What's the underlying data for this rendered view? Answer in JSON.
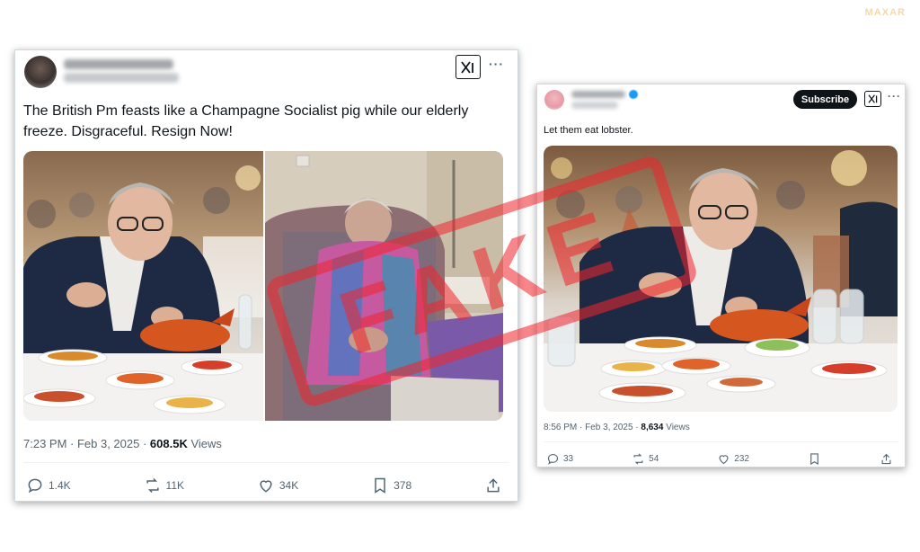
{
  "watermark": "MAXAR",
  "stamp_text": "FAKE",
  "left_post": {
    "text": "The British Pm feasts like a Champagne Socialist pig while our elderly\nfreeze. Disgraceful. Resign Now!",
    "time": "7:23 PM · Feb 3, 2025 · ",
    "views_count": "608.5K",
    "views_label": " Views",
    "replies": "1.4K",
    "reposts": "11K",
    "likes": "34K",
    "bookmarks": "378",
    "images": [
      "man-eating-lobster-dinner",
      "elderly-woman-in-blanket"
    ]
  },
  "right_post": {
    "subscribe_label": "Subscribe",
    "text": "Let them eat lobster.",
    "time": "8:56 PM · Feb 3, 2025 · ",
    "views_count": "8,634",
    "views_label": " Views",
    "replies": "33",
    "reposts": "54",
    "likes": "232",
    "images": [
      "man-eating-lobster-dinner"
    ]
  },
  "colors": {
    "stamp": "#f2252d",
    "text_primary": "#0f1419",
    "text_secondary": "#536471",
    "border": "#cfd9de"
  },
  "icons": [
    "x-logo-icon",
    "more-icon",
    "reply-icon",
    "repost-icon",
    "like-icon",
    "bookmark-icon",
    "share-icon",
    "verified-icon"
  ]
}
